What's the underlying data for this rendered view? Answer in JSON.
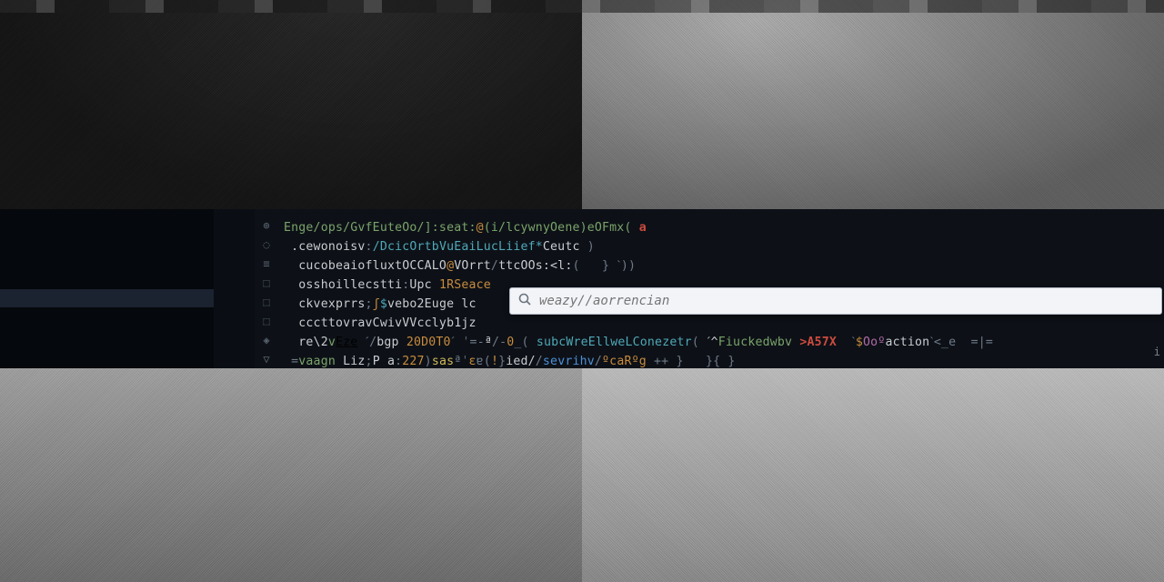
{
  "palette": {
    "placeholder": "weazy//aorrencian"
  },
  "gutter_glyphs": [
    "⊕",
    "◌",
    "≡",
    "⬚",
    "⬚",
    "⬚",
    "◈",
    "▽"
  ],
  "right_margin_char": "i",
  "code_lines": [
    [
      {
        "c": "g",
        "t": "Enge/ops/GvfEuteOo/]:seat:"
      },
      {
        "c": "o",
        "t": "@"
      },
      {
        "c": "g",
        "t": "(i/lcywnyOene)eOFmx("
      },
      {
        "c": "r",
        "t": " a"
      }
    ],
    [
      {
        "c": "w",
        "t": " .cewonoisv"
      },
      {
        "c": "p",
        "t": ":"
      },
      {
        "c": "c",
        "t": "/DcicOrtbVuEaiLucLiief*"
      },
      {
        "c": "w",
        "t": "Ceutc "
      },
      {
        "c": "p",
        "t": ")"
      }
    ],
    [
      {
        "c": "w",
        "t": "  cucobeaiofluxtOCCALO"
      },
      {
        "c": "o",
        "t": "@"
      },
      {
        "c": "w",
        "t": "VOrrt"
      },
      {
        "c": "p",
        "t": "/"
      },
      {
        "c": "w",
        "t": "ttcOOs:<l:"
      },
      {
        "c": "p",
        "t": "(   } ˋ))"
      }
    ],
    [
      {
        "c": "w",
        "t": "  osshoillecstti"
      },
      {
        "c": "p",
        "t": ":"
      },
      {
        "c": "w",
        "t": "Upc "
      },
      {
        "c": "o",
        "t": "1RSeace"
      }
    ],
    [
      {
        "c": "w",
        "t": "  ckvexprrs"
      },
      {
        "c": "p",
        "t": ";"
      },
      {
        "c": "o",
        "t": "ʃ"
      },
      {
        "c": "c",
        "t": "$"
      },
      {
        "c": "w",
        "t": "vebo2Euge lc"
      }
    ],
    [
      {
        "c": "w",
        "t": "  cccttovravCwivVVcclyb1jz"
      }
    ],
    [
      {
        "c": "w",
        "t": "  re\\2"
      },
      {
        "c": "g",
        "t": "v"
      },
      {
        "c": "u",
        "t": "Eze"
      },
      {
        "c": "w",
        "t": " "
      },
      {
        "c": "p",
        "t": "ˊ/"
      },
      {
        "c": "w",
        "t": "bgp "
      },
      {
        "c": "o",
        "t": "20D0T0"
      },
      {
        "c": "p",
        "t": "ˊ ˈ=-"
      },
      {
        "c": "w",
        "t": "ª"
      },
      {
        "c": "p",
        "t": "/-"
      },
      {
        "c": "o",
        "t": "0"
      },
      {
        "c": "p",
        "t": "_("
      },
      {
        "c": "c",
        "t": " subcWreEllweLConezetr"
      },
      {
        "c": "p",
        "t": "( "
      },
      {
        "c": "w",
        "t": "ˊ^"
      },
      {
        "c": "g",
        "t": "Fiuckedwbv"
      },
      {
        "c": "r",
        "t": " >A57X "
      },
      {
        "c": "p",
        "t": " ˋ"
      },
      {
        "c": "o",
        "t": "$"
      },
      {
        "c": "m",
        "t": "Ooº"
      },
      {
        "c": "w",
        "t": "action"
      },
      {
        "c": "p",
        "t": "ˋ<_e  =|="
      }
    ],
    [
      {
        "c": "p",
        "t": " ="
      },
      {
        "c": "g",
        "t": "vaagn"
      },
      {
        "c": "w",
        "t": " Liz"
      },
      {
        "c": "p",
        "t": ";"
      },
      {
        "c": "w",
        "t": "P a"
      },
      {
        "c": "p",
        "t": ":"
      },
      {
        "c": "o",
        "t": "227"
      },
      {
        "c": "p",
        "t": ")"
      },
      {
        "c": "y",
        "t": "sas"
      },
      {
        "c": "p",
        "t": "ªˈ"
      },
      {
        "c": "o",
        "t": "ε"
      },
      {
        "c": "p",
        "t": "ɐ("
      },
      {
        "c": "o",
        "t": "!"
      },
      {
        "c": "p",
        "t": "}"
      },
      {
        "c": "w",
        "t": "ied/"
      },
      {
        "c": "p",
        "t": "/"
      },
      {
        "c": "b",
        "t": "sevrihv"
      },
      {
        "c": "p",
        "t": "/"
      },
      {
        "c": "o",
        "t": "ºcaRºg"
      },
      {
        "c": "p",
        "t": " ++ }   }{ } "
      }
    ]
  ]
}
